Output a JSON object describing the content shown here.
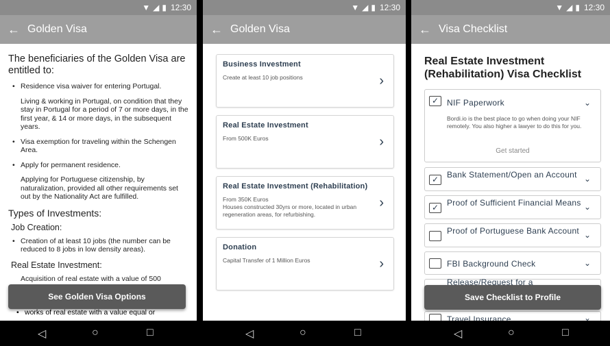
{
  "status": {
    "time": "12:30"
  },
  "screen1": {
    "title": "Golden Visa",
    "intro": "The beneficiaries of the Golden Visa are entitled to:",
    "bullets": [
      "Residence visa waiver for entering Portugal.",
      "Living & working in Portugal, on condition that they stay in Portugal for a period of 7 or more days, in the first year, & 14 or more days, in the subsequent years.",
      "Visa exemption for traveling within the Schengen Area.",
      "Apply for permanent residence.",
      "Applying for Portuguese citizenship, by naturalization, provided all other requirements set out by the Nationality Act are fulfilled."
    ],
    "types_heading": "Types of Investments:",
    "job_heading": "Job Creation:",
    "job_text": "Creation of at least 10 jobs (the number can be reduced to 8 jobs in low density areas).",
    "real_estate_heading": "Real Estate Investment:",
    "real_estate_text": "Acquisition of real estate with a value of 500",
    "works_text": "works of real estate with a value equal or",
    "button": "See Golden Visa Options"
  },
  "screen2": {
    "title": "Golden Visa",
    "cards": [
      {
        "title": "Business Investment",
        "subtitle": "Create at least 10 job positions"
      },
      {
        "title": "Real Estate Investment",
        "subtitle": "From 500K Euros"
      },
      {
        "title": "Real Estate Investment (Rehabilitation)",
        "subtitle": "From 350K Euros\nHouses constructed 30yrs or more, located in urban regeneration areas, for refurbishing."
      },
      {
        "title": "Donation",
        "subtitle": "Capital Transfer of 1 Million Euros"
      }
    ]
  },
  "screen3": {
    "title": "Visa Checklist",
    "heading": "Real Estate Investment (Rehabilitation) Visa Checklist",
    "items": [
      {
        "label": "NIF Paperwork",
        "checked": true
      },
      {
        "label": "Bank Statement/Open an Account",
        "checked": true
      },
      {
        "label": "Proof of Sufficient Financial Means",
        "checked": true
      },
      {
        "label": "Proof of Portuguese Bank Account",
        "checked": false
      },
      {
        "label": "FBI Background Check",
        "checked": false
      },
      {
        "label": "Release/Request for a",
        "checked": false
      },
      {
        "label": "Travel Insurance",
        "checked": false
      }
    ],
    "nif_description": "Bordi.io is the best place to go when doing your NIF remotely. You also higher a lawyer to do this for you.",
    "get_started": "Get started",
    "button": "Save Checklist to Profile"
  },
  "icons": {
    "back": "arrow-left-icon",
    "chevron": "chevron-right-icon",
    "expand": "chevron-down-icon"
  },
  "colors": {
    "appbar": "#9e9e9e",
    "statusbar": "#8b8b8b",
    "button": "#5a5a5a",
    "heading_text": "#2d3e50"
  }
}
